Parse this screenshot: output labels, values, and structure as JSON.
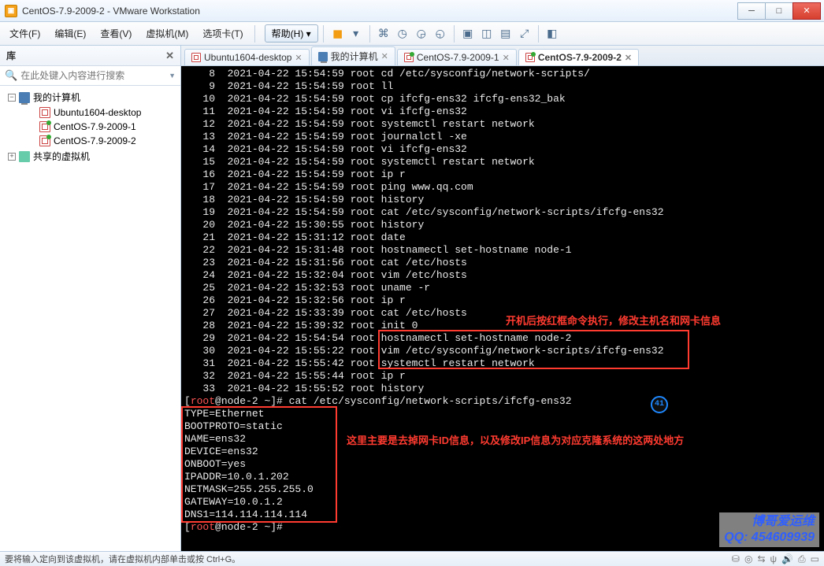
{
  "window": {
    "app_icon_glyph": "▣",
    "title": "CentOS-7.9-2009-2 - VMware Workstation"
  },
  "menu": {
    "file": "文件(F)",
    "edit": "编辑(E)",
    "view": "查看(V)",
    "vm": "虚拟机(M)",
    "tabs": "选项卡(T)",
    "help": "帮助(H)"
  },
  "sidebar": {
    "header": "库",
    "search_placeholder": "在此处键入内容进行搜索",
    "nodes": {
      "root": "我的计算机",
      "vm1": "Ubuntu1604-desktop",
      "vm2": "CentOS-7.9-2009-1",
      "vm3": "CentOS-7.9-2009-2",
      "shared": "共享的虚拟机"
    }
  },
  "tabs": [
    {
      "label": "Ubuntu1604-desktop"
    },
    {
      "label": "我的计算机"
    },
    {
      "label": "CentOS-7.9-2009-1"
    },
    {
      "label": "CentOS-7.9-2009-2"
    }
  ],
  "terminal": {
    "history_lines": [
      "    8  2021-04-22 15:54:59 root cd /etc/sysconfig/network-scripts/",
      "    9  2021-04-22 15:54:59 root ll",
      "   10  2021-04-22 15:54:59 root cp ifcfg-ens32 ifcfg-ens32_bak",
      "   11  2021-04-22 15:54:59 root vi ifcfg-ens32",
      "   12  2021-04-22 15:54:59 root systemctl restart network",
      "   13  2021-04-22 15:54:59 root journalctl -xe",
      "   14  2021-04-22 15:54:59 root vi ifcfg-ens32",
      "   15  2021-04-22 15:54:59 root systemctl restart network",
      "   16  2021-04-22 15:54:59 root ip r",
      "   17  2021-04-22 15:54:59 root ping www.qq.com",
      "   18  2021-04-22 15:54:59 root history",
      "   19  2021-04-22 15:54:59 root cat /etc/sysconfig/network-scripts/ifcfg-ens32",
      "   20  2021-04-22 15:30:55 root history",
      "   21  2021-04-22 15:31:12 root date",
      "   22  2021-04-22 15:31:48 root hostnamectl set-hostname node-1",
      "   23  2021-04-22 15:31:56 root cat /etc/hosts",
      "   24  2021-04-22 15:32:04 root vim /etc/hosts",
      "   25  2021-04-22 15:32:53 root uname -r",
      "   26  2021-04-22 15:32:56 root ip r",
      "   27  2021-04-22 15:33:39 root cat /etc/hosts",
      "   28  2021-04-22 15:39:32 root init 0",
      "   29  2021-04-22 15:54:54 root hostnamectl set-hostname node-2",
      "   30  2021-04-22 15:55:22 root vim /etc/sysconfig/network-scripts/ifcfg-ens32",
      "   31  2021-04-22 15:55:42 root systemctl restart network",
      "   32  2021-04-22 15:55:44 root ip r",
      "   33  2021-04-22 15:55:52 root history"
    ],
    "prompt_user": "root",
    "prompt_host": "node-2",
    "prompt_path": "~",
    "prompt_cmd": "cat /etc/sysconfig/network-scripts/ifcfg-ens32",
    "config_lines": [
      "TYPE=Ethernet",
      "BOOTPROTO=static",
      "NAME=ens32",
      "DEVICE=ens32",
      "ONBOOT=yes",
      "IPADDR=10.0.1.202",
      "NETMASK=255.255.255.0",
      "GATEWAY=10.0.1.2",
      "DNS1=114.114.114.114"
    ],
    "prompt2_cmd": ""
  },
  "annotations": {
    "note1": "开机后按红框命令执行，修改主机名和网卡信息",
    "note2": "这里主要是去掉网卡ID信息，以及修改IP信息为对应克隆系统的这两处地方",
    "badge": "41"
  },
  "watermark": {
    "line1": "博哥爱运维",
    "line2": "QQ: 454609939"
  },
  "statusbar": {
    "text": "要将输入定向到该虚拟机，请在虚拟机内部单击或按 Ctrl+G。"
  }
}
